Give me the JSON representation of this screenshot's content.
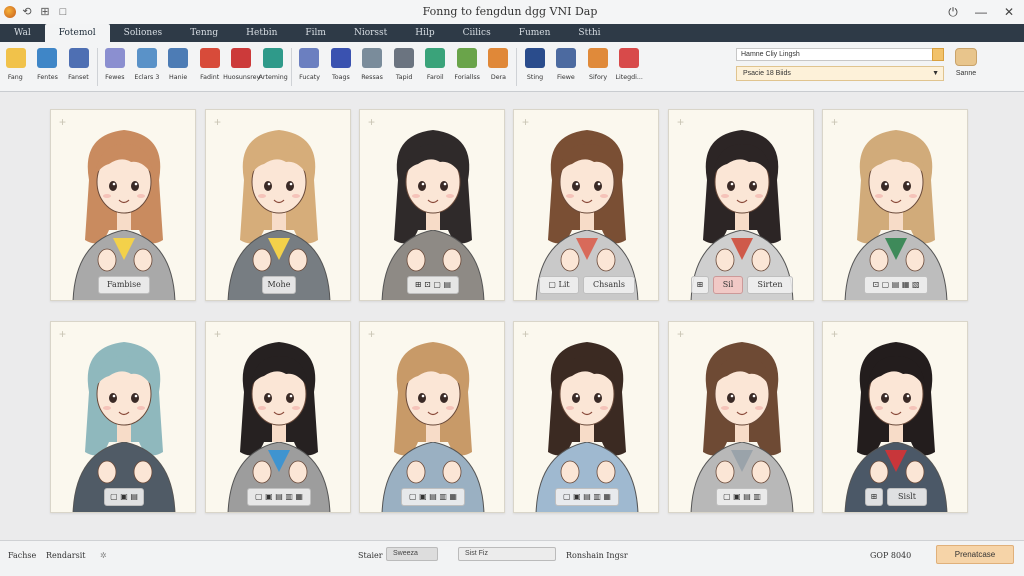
{
  "window": {
    "title": "Fonng to fengdun dgg VNI Dap",
    "left_buttons": [
      "⟲",
      "⊞",
      "□"
    ],
    "right_buttons": [
      "⏻",
      "—",
      "✕"
    ]
  },
  "tabs": [
    "Wal",
    "Fotemol",
    "Soliones",
    "Tenng",
    "Hetbin",
    "Film",
    "Niorsst",
    "Hilp",
    "Ciilics",
    "Fumen",
    "Stthi"
  ],
  "active_tab": 1,
  "tools": [
    {
      "label": "Fang",
      "icon": "folder-icon",
      "color": "#f1c24a"
    },
    {
      "label": "Fentes",
      "icon": "globe-icon",
      "color": "#3f86c7"
    },
    {
      "label": "Fanset",
      "icon": "document-icon",
      "color": "#4e6fb3"
    },
    {
      "label": "Fewes",
      "icon": "pen-icon",
      "color": "#8b8fd0"
    },
    {
      "label": "Eclars 3",
      "icon": "brush-icon",
      "color": "#5a92c8"
    },
    {
      "label": "Hanie",
      "icon": "layers-icon",
      "color": "#4d7cb5"
    },
    {
      "label": "Fadint",
      "icon": "triangle-icon",
      "color": "#d84b3a"
    },
    {
      "label": "Huosunsrey",
      "icon": "image-icon",
      "color": "#cc3a3a"
    },
    {
      "label": "Arteming",
      "icon": "gem-icon",
      "color": "#2f9a8a"
    },
    {
      "label": "Fucaty",
      "icon": "arrow-icon",
      "color": "#6b7fc0"
    },
    {
      "label": "Toags",
      "icon": "ring-icon",
      "color": "#3a52b0"
    },
    {
      "label": "Ressas",
      "icon": "star-icon",
      "color": "#7a8c9b"
    },
    {
      "label": "Tapid",
      "icon": "box-icon",
      "color": "#6b7480"
    },
    {
      "label": "Faroil",
      "icon": "pin-icon",
      "color": "#3aa37a"
    },
    {
      "label": "Foriallss",
      "icon": "wand-icon",
      "color": "#6aa44a"
    },
    {
      "label": "Dera",
      "icon": "swirl-icon",
      "color": "#e08838"
    },
    {
      "label": "Sting",
      "icon": "spark-icon",
      "color": "#2a4c8c"
    },
    {
      "label": "Fiewe",
      "icon": "stack-icon",
      "color": "#4c6aa0"
    },
    {
      "label": "Sifory",
      "icon": "palette-icon",
      "color": "#e08a3a"
    },
    {
      "label": "Litegdi...",
      "icon": "book-icon",
      "color": "#d84a4a"
    }
  ],
  "search_field": {
    "value": "Hamne Cliy Lingsh"
  },
  "preset_select": {
    "value": "Psacie 18 Biids"
  },
  "ribbon_action": {
    "label": "Sanne",
    "icon": "export-icon"
  },
  "cards": [
    {
      "chips": [
        {
          "t": "Fambise"
        }
      ],
      "hair": "#c98b5f",
      "top": "#a9a9a9",
      "accent": "#f3d14a"
    },
    {
      "chips": [
        {
          "t": "Mohe"
        }
      ],
      "hair": "#d6ad7a",
      "top": "#777d82",
      "accent": "#f3d14a"
    },
    {
      "chips": [
        {
          "t": "⊞ ⊡ ▢ ▤"
        }
      ],
      "hair": "#2f2a2a",
      "top": "#8e8a85",
      "accent": ""
    },
    {
      "chips": [
        {
          "t": "▢ Lit"
        },
        {
          "t": "Chsanls"
        }
      ],
      "hair": "#7a4f34",
      "top": "#c9c9c9",
      "accent": "#d86a5a"
    },
    {
      "chips": [
        {
          "t": "⊞"
        },
        {
          "t": "Sil",
          "pink": true
        },
        {
          "t": "Sirten"
        }
      ],
      "hair": "#2c2525",
      "top": "#cfcfcf",
      "accent": "#cf5a4a"
    },
    {
      "chips": [
        {
          "t": "⊡ ▢ ▤ ▦ ▧"
        }
      ],
      "hair": "#d1ab7a",
      "top": "#bdbdbd",
      "accent": "#3e8a5a"
    },
    {
      "chips": [
        {
          "t": "▢ ▣ ▤"
        }
      ],
      "hair": "#8fb8bd",
      "top": "#505b66",
      "accent": ""
    },
    {
      "chips": [
        {
          "t": "▢ ▣ ▤ ▥ ▦"
        }
      ],
      "hair": "#262121",
      "top": "#9d9d9d",
      "accent": "#3f94d0"
    },
    {
      "chips": [
        {
          "t": "▢ ▣ ▤ ▥ ▦"
        }
      ],
      "hair": "#c89a68",
      "top": "#9ab0c2",
      "accent": ""
    },
    {
      "chips": [
        {
          "t": "▢ ▣ ▤ ▥ ▦"
        }
      ],
      "hair": "#3b2a22",
      "top": "#9fb9d0",
      "accent": ""
    },
    {
      "chips": [
        {
          "t": "▢ ▣ ▤ ▥"
        }
      ],
      "hair": "#6e4a34",
      "top": "#b8b8b8",
      "accent": "#9aa3aa"
    },
    {
      "chips": [
        {
          "t": "⊞"
        },
        {
          "t": "Sislt"
        }
      ],
      "hair": "#231d1d",
      "top": "#4b5867",
      "accent": "#c8363a"
    }
  ],
  "statusbar": {
    "left1": "Fachse",
    "left2": "Rendarsit",
    "mid_label": "Staier",
    "toggle": "Sweeza",
    "select": "Sist Fiz",
    "right_text": "Ronshain Ingsr",
    "zoom": "GOP 8040",
    "button": "Prenatcase"
  }
}
